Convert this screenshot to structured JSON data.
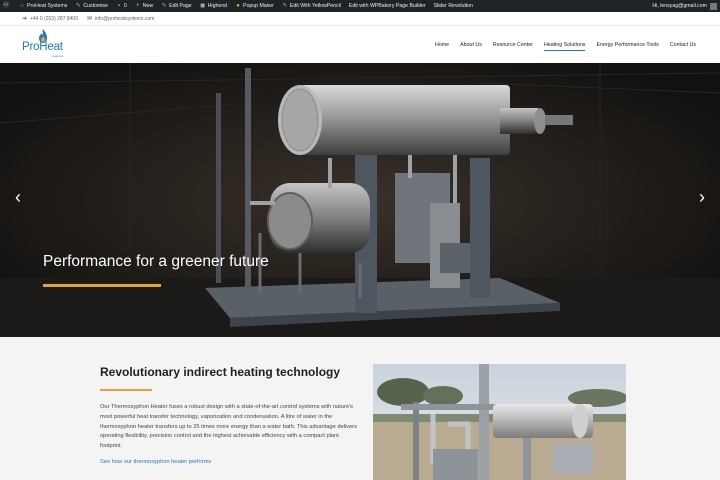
{
  "adminbar": {
    "items": [
      {
        "icon": "wordpress-icon",
        "label": ""
      },
      {
        "icon": "home-icon",
        "label": "ProHeat Systems"
      },
      {
        "icon": "brush-icon",
        "label": "Customise"
      },
      {
        "icon": "comment-icon",
        "label": "0"
      },
      {
        "icon": "plus-icon",
        "label": "New"
      },
      {
        "icon": "pencil-icon",
        "label": "Edit Page"
      },
      {
        "icon": "highend-icon",
        "label": "Highend"
      },
      {
        "icon": "popup-icon",
        "label": "Popup Maker"
      },
      {
        "icon": "pencil-icon",
        "label": "Edit With YellowPencil"
      },
      {
        "icon": "",
        "label": "Edit with WPBakery Page Builder"
      },
      {
        "icon": "",
        "label": "Slider Revolution"
      }
    ],
    "greeting": "Hi, lensyag@gmail.com"
  },
  "topstrip": {
    "phone": "+44 0 (203) 287 8400",
    "email": "info@proheatsystems.com"
  },
  "logo": {
    "brand": "ProHeat",
    "sub": "systems"
  },
  "nav": {
    "items": [
      "Home",
      "About Us",
      "Resource Center",
      "Heating Solutions",
      "Energy Performance Tools",
      "Contact Us"
    ],
    "active": "Heating Solutions"
  },
  "hero": {
    "title": "Performance for a greener future",
    "prev": "‹",
    "next": "›"
  },
  "section": {
    "title": "Revolutionary indirect heating technology",
    "body": "Our Thermosyphon Heater fuses a robust design with a state-of-the-art control systems with nature's most powerful heat transfer technology, vaporization and condensation.  A litre of water in the thermosyphon heater transfers up to 25 times more energy than a water bath. This advantage delivers operating flexibility, precision control and the highest achievable efficiency with a compact plant footprint.",
    "link": "See how our thermosyphon heater performs"
  },
  "colors": {
    "accent": "#e5a238",
    "brand": "#1a7bc4",
    "adminbar": "#1d2327"
  }
}
